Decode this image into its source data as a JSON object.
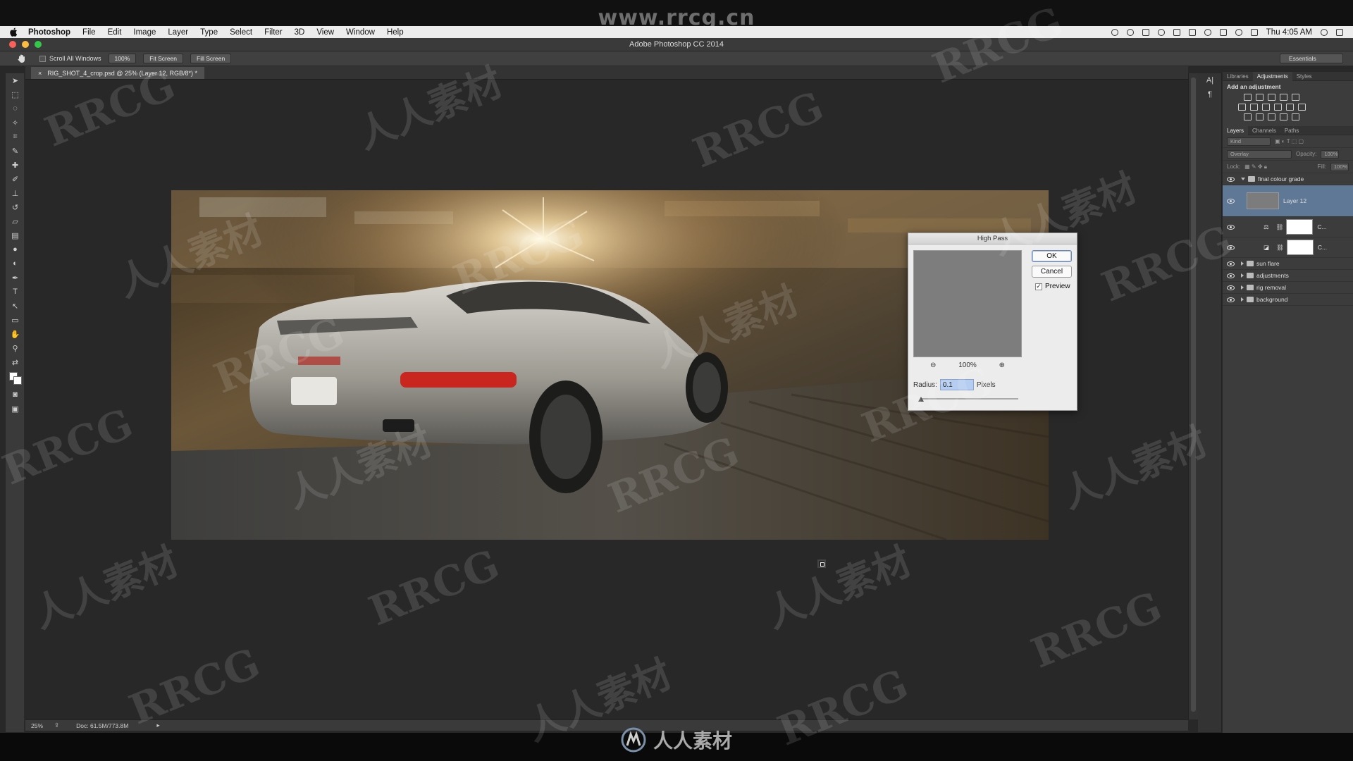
{
  "watermark_top": "www.rrcg.cn",
  "menubar": {
    "app": "Photoshop",
    "items": [
      "File",
      "Edit",
      "Image",
      "Layer",
      "Type",
      "Select",
      "Filter",
      "3D",
      "View",
      "Window",
      "Help"
    ],
    "clock": "Thu 4:05 AM"
  },
  "window": {
    "title": "Adobe Photoshop CC 2014"
  },
  "options_bar": {
    "scroll_all": "Scroll All Windows",
    "zoom_btn": "100%",
    "fit_btn": "Fit Screen",
    "fill_btn": "Fill Screen",
    "workspace": "Essentials"
  },
  "document": {
    "tab": "RIG_SHOT_4_crop.psd @ 25% (Layer 12, RGB/8*) *"
  },
  "status": {
    "zoom": "25%",
    "doc": "Doc: 61.5M/773.8M"
  },
  "panels": {
    "top_tabs": [
      "Libraries",
      "Adjustments",
      "Styles"
    ],
    "adj_title": "Add an adjustment",
    "layer_tabs": [
      "Layers",
      "Channels",
      "Paths"
    ],
    "filter_kind": "Kind",
    "blend_mode": "Overlay",
    "opacity_label": "Opacity:",
    "opacity_value": "100%",
    "lock_label": "Lock:",
    "fill_label": "Fill:",
    "fill_value": "100%",
    "layers": [
      {
        "name": "final colour grade"
      },
      {
        "name": "Layer 12"
      },
      {
        "name": "C..."
      },
      {
        "name": "C..."
      },
      {
        "name": "sun flare"
      },
      {
        "name": "adjustments"
      },
      {
        "name": "rig removal"
      },
      {
        "name": "background"
      }
    ]
  },
  "dialog": {
    "title": "High Pass",
    "ok": "OK",
    "cancel": "Cancel",
    "preview": "Preview",
    "zoom": "100%",
    "radius_label": "Radius:",
    "radius_value": "0.1",
    "unit": "Pixels"
  },
  "bottom_logo": "人人素材",
  "watermarks": {
    "rrcg": "RRCG",
    "cn": "人人素材"
  }
}
